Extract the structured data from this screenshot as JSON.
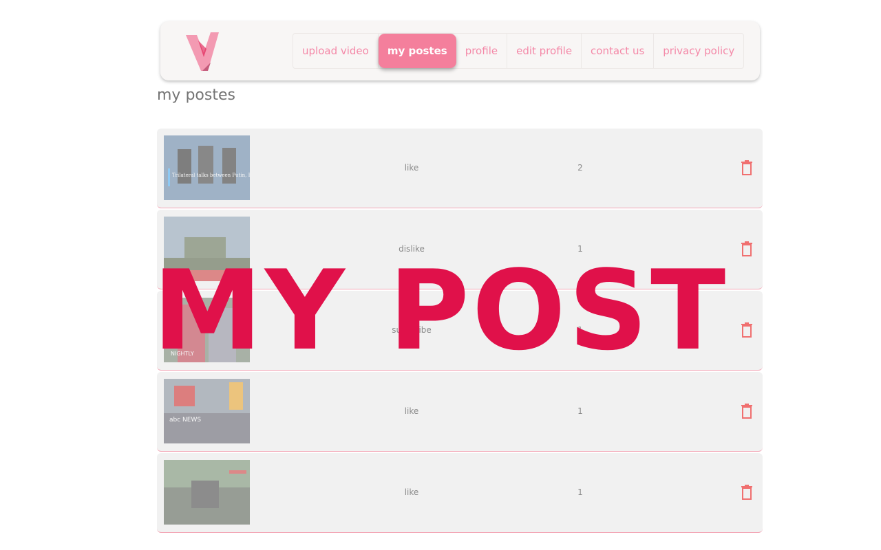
{
  "nav": {
    "logo": "v-logo-icon",
    "links": [
      {
        "label": "upload video"
      },
      {
        "label": "my postes",
        "active": true
      },
      {
        "label": "profile"
      },
      {
        "label": "edit profile"
      },
      {
        "label": "contact us"
      },
      {
        "label": "privacy policy"
      }
    ]
  },
  "page": {
    "title": "my postes"
  },
  "posts": [
    {
      "thumbnail_caption": "Trilateral talks between Putin, Raisi and Erdogan",
      "reaction": "like",
      "count": "2"
    },
    {
      "thumbnail_caption": "Sun",
      "reaction": "dislike",
      "count": "1"
    },
    {
      "thumbnail_caption": "NIGHTLY",
      "reaction": "subscribe",
      "count": "1"
    },
    {
      "thumbnail_caption": "abc NEWS",
      "reaction": "like",
      "count": "1"
    },
    {
      "thumbnail_caption": "",
      "reaction": "like",
      "count": "1"
    }
  ],
  "overlay": {
    "text": "MY POST"
  },
  "colors": {
    "accent": "#f47f9c",
    "overlay": "#e0114a",
    "trash": "#f07070"
  }
}
